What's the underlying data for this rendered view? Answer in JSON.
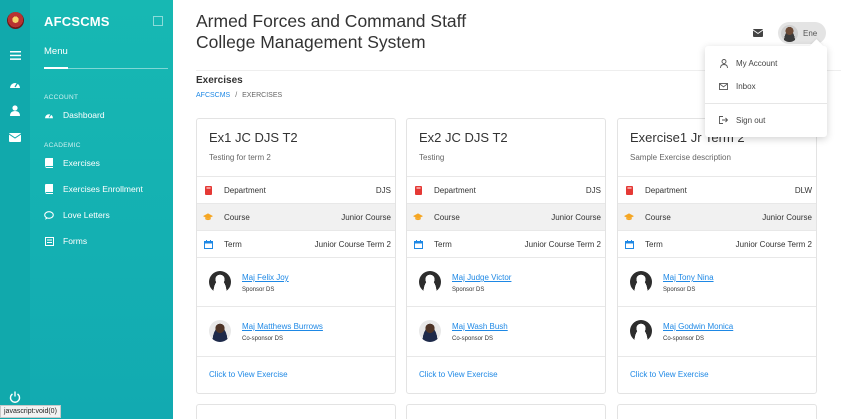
{
  "brand": "AFCSCMS",
  "menu_title": "Menu",
  "sections": {
    "account": "ACCOUNT",
    "academic": "ACADEMIC"
  },
  "nav": {
    "dashboard": "Dashboard",
    "exercises": "Exercises",
    "exercises_enrollment": "Exercises Enrollment",
    "love_letters": "Love Letters",
    "forms": "Forms"
  },
  "header": {
    "title": "Armed Forces and Command Staff\nCollege Management System",
    "user_name": "Ene"
  },
  "page": {
    "heading": "Exercises",
    "breadcrumb_root": "AFCSCMS",
    "breadcrumb_sep": "/",
    "breadcrumb_current": "EXERCISES"
  },
  "labels": {
    "department": "Department",
    "course": "Course",
    "term": "Term",
    "view_link": "Click to View Exercise"
  },
  "cards": [
    {
      "title": "Ex1 JC DJS T2",
      "description": "Testing for term 2",
      "department": "DJS",
      "course": "Junior Course",
      "term": "Junior Course Term 2",
      "sponsor": {
        "name": "Maj Felix Joy",
        "role": "Sponsor DS"
      },
      "cosponsor": {
        "name": "Maj Matthews Burrows",
        "role": "Co-sponsor DS"
      }
    },
    {
      "title": "Ex2 JC DJS T2",
      "description": "Testing",
      "department": "DJS",
      "course": "Junior Course",
      "term": "Junior Course Term 2",
      "sponsor": {
        "name": "Maj Judge Victor",
        "role": "Sponsor DS"
      },
      "cosponsor": {
        "name": "Maj Wash Bush",
        "role": "Co-sponsor DS"
      }
    },
    {
      "title": "Exercise1 Jr Term 2",
      "description": "Sample Exercise description",
      "department": "DLW",
      "course": "Junior Course",
      "term": "Junior Course Term 2",
      "sponsor": {
        "name": "Maj Tony Nina",
        "role": "Sponsor DS"
      },
      "cosponsor": {
        "name": "Maj Godwin Monica",
        "role": "Co-sponsor DS"
      }
    }
  ],
  "dropdown": {
    "my_account": "My Account",
    "inbox": "Inbox",
    "sign_out": "Sign out"
  },
  "status_bar": "javascript:void(0)",
  "colors": {
    "sidebar": "#13b0b2",
    "link": "#1e88e5",
    "department_icon": "#e53935",
    "course_icon": "#f5a623",
    "term_icon": "#1e88e5"
  }
}
